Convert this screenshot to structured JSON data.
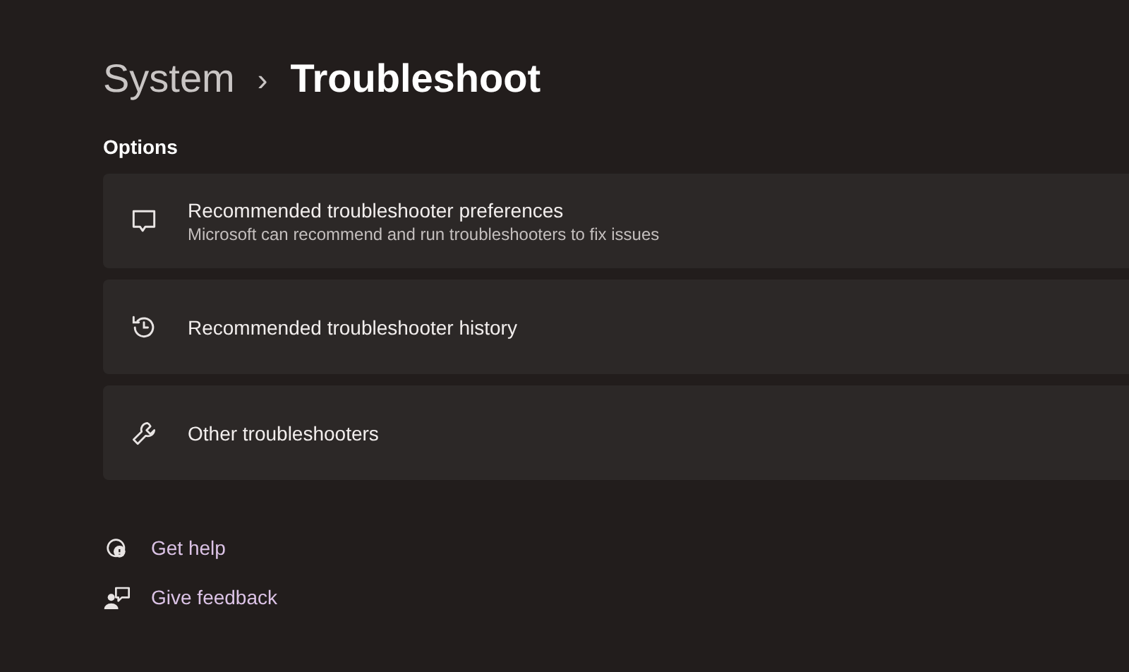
{
  "breadcrumb": {
    "parent": "System",
    "separator": "›",
    "current": "Troubleshoot"
  },
  "section_title": "Options",
  "options": [
    {
      "kind": "chat",
      "title": "Recommended troubleshooter preferences",
      "subtitle": "Microsoft can recommend and run troubleshooters to fix issues"
    },
    {
      "kind": "history",
      "title": "Recommended troubleshooter history"
    },
    {
      "kind": "wrench",
      "title": "Other troubleshooters"
    }
  ],
  "links": [
    {
      "kind": "help",
      "label": "Get help"
    },
    {
      "kind": "feedback",
      "label": "Give feedback"
    }
  ]
}
